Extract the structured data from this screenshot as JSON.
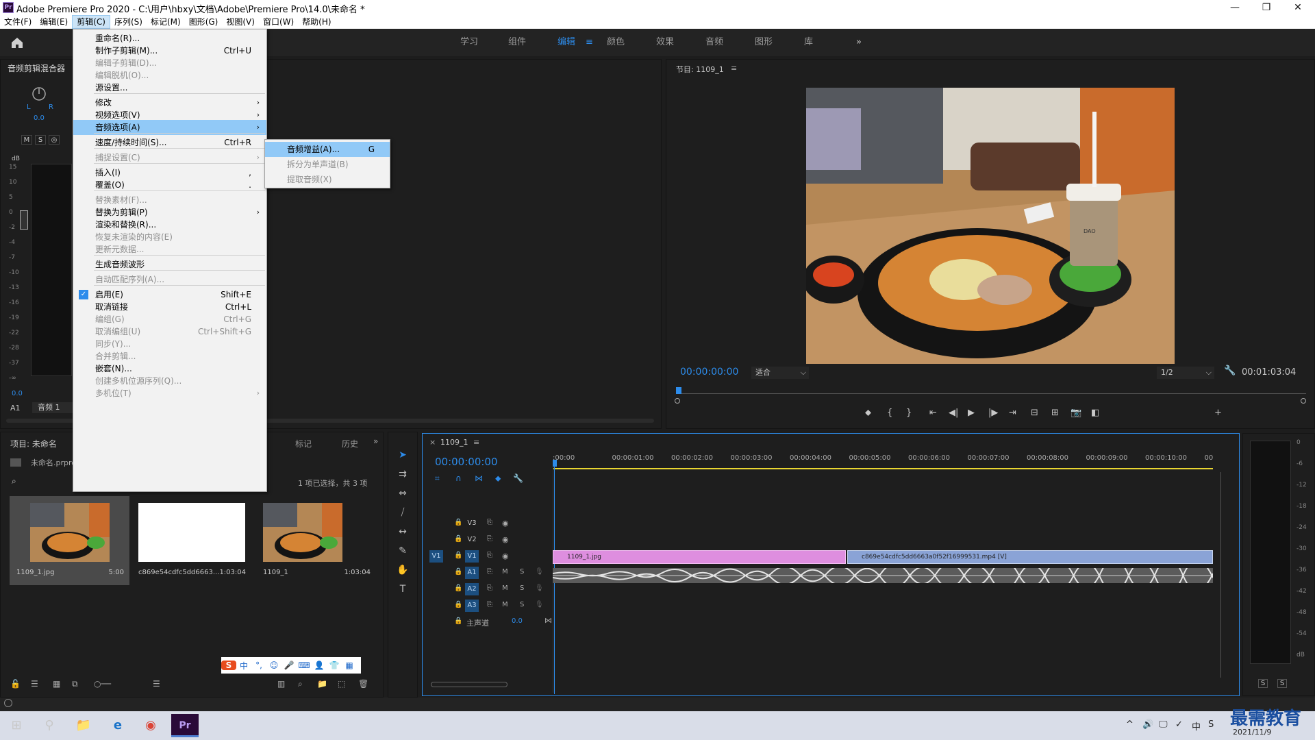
{
  "window": {
    "title": "Adobe Premiere Pro 2020 - C:\\用户\\hbxy\\文档\\Adobe\\Premiere Pro\\14.0\\未命名 *",
    "logo": "Pr",
    "controls": [
      "—",
      "❐",
      "✕"
    ]
  },
  "menubar": [
    {
      "label": "文件(F)",
      "active": false
    },
    {
      "label": "编辑(E)",
      "active": false
    },
    {
      "label": "剪辑(C)",
      "active": true
    },
    {
      "label": "序列(S)",
      "active": false
    },
    {
      "label": "标记(M)",
      "active": false
    },
    {
      "label": "图形(G)",
      "active": false
    },
    {
      "label": "视图(V)",
      "active": false
    },
    {
      "label": "窗口(W)",
      "active": false
    },
    {
      "label": "帮助(H)",
      "active": false
    }
  ],
  "workspace": {
    "tabs": [
      "学习",
      "组件",
      "编辑",
      "颜色",
      "效果",
      "音频",
      "图形",
      "库"
    ],
    "active": "编辑",
    "more": "»",
    "menu_icon": "≡"
  },
  "mixer": {
    "title": "音频剪辑混合器",
    "pan_l": "L",
    "pan_r": "R",
    "pan_value": "0.0",
    "msr": [
      "M",
      "S",
      "◎"
    ],
    "db_unit": "dB",
    "scale": [
      "15",
      "10",
      "5",
      "0",
      "-2",
      "-4",
      "-7",
      "-10",
      "-13",
      "-16",
      "-19",
      "-22",
      "-28",
      "-37",
      "-∞"
    ],
    "fader_value": "0.0",
    "track": "A1",
    "track_name": "音频 1"
  },
  "program": {
    "title": "节目: 1109_1",
    "menu_icon": "≡",
    "timecode": "00:00:00:00",
    "fit": "适合",
    "resolution": "1/2",
    "duration": "00:01:03:04",
    "photo_cup_text": "DAO"
  },
  "project": {
    "title": "项目: 未命名",
    "tabs": [
      "标记",
      "历史"
    ],
    "file": "未命名.prproj",
    "selection": "1 项已选择，共 3 项",
    "items": [
      {
        "name": "1109_1.jpg",
        "duration": "5:00"
      },
      {
        "name": "c869e54cdfc5dd6663...",
        "duration": "1:03:04"
      },
      {
        "name": "1109_1",
        "duration": "1:03:04"
      }
    ],
    "ime": [
      "S",
      "中",
      "°,",
      "☺",
      "🎤",
      "⌨",
      "👤",
      "👕",
      "▦"
    ]
  },
  "timeline": {
    "tab": "1109_1",
    "close": "×",
    "timecode": "00:00:00:00",
    "ruler": [
      ":00:00",
      "00:00:01:00",
      "00:00:02:00",
      "00:00:03:00",
      "00:00:04:00",
      "00:00:05:00",
      "00:00:06:00",
      "00:00:07:00",
      "00:00:08:00",
      "00:00:09:00",
      "00:00:10:00",
      "00"
    ],
    "tracks": [
      {
        "name": "V3",
        "kind": "video"
      },
      {
        "name": "V2",
        "kind": "video"
      },
      {
        "name": "V1",
        "kind": "video",
        "src": "V1"
      },
      {
        "name": "A1",
        "kind": "audio"
      },
      {
        "name": "A2",
        "kind": "audio"
      },
      {
        "name": "A3",
        "kind": "audio"
      }
    ],
    "master": "主声道",
    "master_value": "0.0",
    "clip_image": "1109_1.jpg",
    "clip_video": "c869e54cdfc5dd6663a0f52f16999531.mp4 [V]"
  },
  "right_meter": {
    "scale": [
      "0",
      "-6",
      "-12",
      "-18",
      "-24",
      "-30",
      "-36",
      "-42",
      "-48",
      "-54",
      "dB"
    ],
    "solo": [
      "S",
      "S"
    ]
  },
  "clip_menu": [
    {
      "label": "重命名(R)...",
      "shortcut": "",
      "disabled": false
    },
    {
      "label": "制作子剪辑(M)...",
      "shortcut": "Ctrl+U",
      "disabled": false
    },
    {
      "label": "编辑子剪辑(D)...",
      "shortcut": "",
      "disabled": true
    },
    {
      "label": "编辑脱机(O)...",
      "shortcut": "",
      "disabled": true
    },
    {
      "label": "源设置...",
      "shortcut": "",
      "disabled": false
    },
    {
      "sep": true
    },
    {
      "label": "修改",
      "shortcut": "",
      "disabled": false,
      "sub": true
    },
    {
      "label": "视频选项(V)",
      "shortcut": "",
      "disabled": false,
      "sub": true
    },
    {
      "label": "音频选项(A)",
      "shortcut": "",
      "disabled": false,
      "sub": true,
      "highlight": true
    },
    {
      "sep": true
    },
    {
      "label": "速度/持续时间(S)...",
      "shortcut": "Ctrl+R",
      "disabled": false
    },
    {
      "sep": true
    },
    {
      "label": "捕捉设置(C)",
      "shortcut": "",
      "disabled": true,
      "sub": true
    },
    {
      "sep": true
    },
    {
      "label": "插入(I)",
      "shortcut": ",",
      "disabled": false
    },
    {
      "label": "覆盖(O)",
      "shortcut": ".",
      "disabled": false
    },
    {
      "sep": true
    },
    {
      "label": "替换素材(F)...",
      "shortcut": "",
      "disabled": true
    },
    {
      "label": "替换为剪辑(P)",
      "shortcut": "",
      "disabled": false,
      "sub": true
    },
    {
      "label": "渲染和替换(R)...",
      "shortcut": "",
      "disabled": false
    },
    {
      "label": "恢复未渲染的内容(E)",
      "shortcut": "",
      "disabled": true
    },
    {
      "label": "更新元数据...",
      "shortcut": "",
      "disabled": true
    },
    {
      "sep": true
    },
    {
      "label": "生成音频波形",
      "shortcut": "",
      "disabled": false
    },
    {
      "sep": true
    },
    {
      "label": "自动匹配序列(A)...",
      "shortcut": "",
      "disabled": true
    },
    {
      "sep": true
    },
    {
      "label": "启用(E)",
      "shortcut": "Shift+E",
      "disabled": false,
      "checked": true
    },
    {
      "label": "取消链接",
      "shortcut": "Ctrl+L",
      "disabled": false
    },
    {
      "label": "编组(G)",
      "shortcut": "Ctrl+G",
      "disabled": true
    },
    {
      "label": "取消编组(U)",
      "shortcut": "Ctrl+Shift+G",
      "disabled": true
    },
    {
      "label": "同步(Y)...",
      "shortcut": "",
      "disabled": true
    },
    {
      "label": "合并剪辑...",
      "shortcut": "",
      "disabled": true
    },
    {
      "label": "嵌套(N)...",
      "shortcut": "",
      "disabled": false
    },
    {
      "label": "创建多机位源序列(Q)...",
      "shortcut": "",
      "disabled": true
    },
    {
      "label": "多机位(T)",
      "shortcut": "",
      "disabled": true,
      "sub": true
    }
  ],
  "audio_submenu": [
    {
      "label": "音频增益(A)...",
      "shortcut": "G",
      "disabled": false,
      "highlight": true
    },
    {
      "label": "拆分为单声道(B)",
      "shortcut": "",
      "disabled": true
    },
    {
      "label": "提取音频(X)",
      "shortcut": "",
      "disabled": true
    }
  ],
  "taskbar": {
    "apps": [
      "⊞",
      "⚲",
      "📁",
      "e",
      "◉",
      "Pr"
    ],
    "tray": [
      "^",
      "🔊",
      "🖵",
      "✓",
      "中",
      "S"
    ],
    "date": "2021/11/9",
    "watermark": "最需教育"
  }
}
